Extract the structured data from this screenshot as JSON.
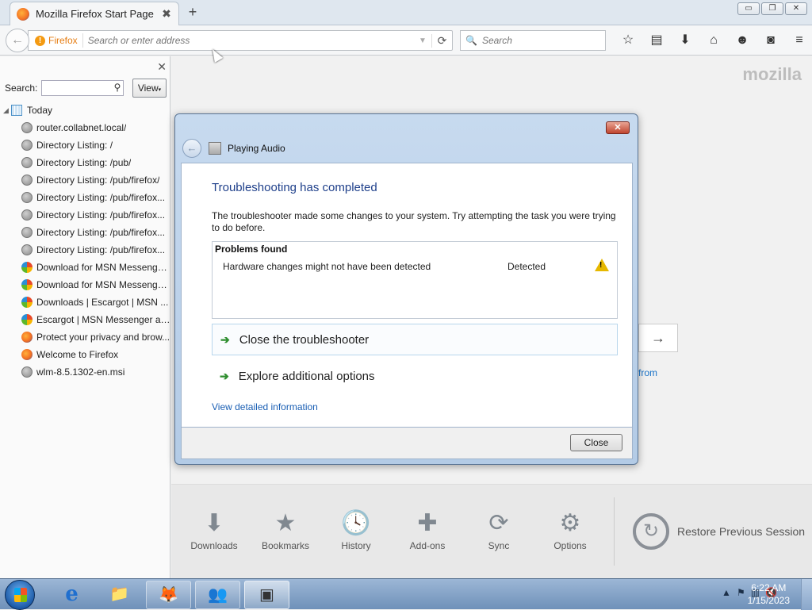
{
  "tab": {
    "title": "Mozilla Firefox Start Page",
    "close": "✖",
    "new_tab": "+"
  },
  "window_buttons": [
    "▭",
    "❐",
    "✕"
  ],
  "navbar": {
    "back": "←",
    "identity_label": "Firefox",
    "address_placeholder": "Search or enter address",
    "reload": "⟳",
    "search_placeholder": "Search",
    "tool_icons": [
      "star-icon",
      "reading-list-icon",
      "download-icon",
      "home-icon",
      "hello-icon",
      "pocket-icon",
      "menu-icon"
    ]
  },
  "sidebar": {
    "close": "✕",
    "search_label": "Search:",
    "search_value": "",
    "view_label": "View",
    "group_label": "Today",
    "items": [
      {
        "label": "router.collabnet.local/",
        "icon": "globe"
      },
      {
        "label": "Directory Listing: /",
        "icon": "globe"
      },
      {
        "label": "Directory Listing: /pub/",
        "icon": "globe"
      },
      {
        "label": "Directory Listing: /pub/firefox/",
        "icon": "globe"
      },
      {
        "label": "Directory Listing: /pub/firefox...",
        "icon": "globe"
      },
      {
        "label": "Directory Listing: /pub/firefox...",
        "icon": "globe"
      },
      {
        "label": "Directory Listing: /pub/firefox...",
        "icon": "globe"
      },
      {
        "label": "Directory Listing: /pub/firefox...",
        "icon": "globe"
      },
      {
        "label": "Download for MSN Messenge...",
        "icon": "msn"
      },
      {
        "label": "Download for MSN Messenge...",
        "icon": "msn"
      },
      {
        "label": "Downloads | Escargot | MSN ...",
        "icon": "msn"
      },
      {
        "label": "Escargot | MSN Messenger an...",
        "icon": "msn"
      },
      {
        "label": "Protect your privacy and brow...",
        "icon": "ff"
      },
      {
        "label": "Welcome to Firefox",
        "icon": "ff"
      },
      {
        "label": "wlm-8.5.1302-en.msi",
        "icon": "globe"
      }
    ]
  },
  "content": {
    "logo": "mozilla",
    "go_arrow": "→",
    "from_link": "from",
    "launcher": [
      {
        "label": "Downloads",
        "icon": "⬇"
      },
      {
        "label": "Bookmarks",
        "icon": "★"
      },
      {
        "label": "History",
        "icon": "🕓"
      },
      {
        "label": "Add-ons",
        "icon": "✚"
      },
      {
        "label": "Sync",
        "icon": "⟳"
      },
      {
        "label": "Options",
        "icon": "⚙"
      }
    ],
    "restore_label": "Restore Previous Session",
    "restore_icon": "↻"
  },
  "dialog": {
    "close_x": "✕",
    "back": "←",
    "title": "Playing Audio",
    "heading": "Troubleshooting has completed",
    "description": "The troubleshooter made some changes to your system. Try attempting the task you were trying to do before.",
    "problems_header": "Problems found",
    "problem_text": "Hardware changes might not have been detected",
    "problem_status": "Detected",
    "commands": [
      "Close the troubleshooter",
      "Explore additional options"
    ],
    "command_arrow": "➔",
    "detail_link": "View detailed information",
    "close_button": "Close"
  },
  "taskbar": {
    "apps": [
      {
        "name": "ie-icon",
        "glyph": "e",
        "state": "none"
      },
      {
        "name": "explorer-icon",
        "glyph": "📁",
        "state": "none"
      },
      {
        "name": "firefox-icon",
        "glyph": "🦊",
        "state": "open"
      },
      {
        "name": "messenger-icon",
        "glyph": "👥",
        "state": "open"
      },
      {
        "name": "troubleshooter-icon",
        "glyph": "▣",
        "state": "active"
      }
    ],
    "tray": [
      "▲",
      "⚑",
      "▥",
      "🔇"
    ],
    "time": "6:22 AM",
    "date": "1/15/2023"
  }
}
